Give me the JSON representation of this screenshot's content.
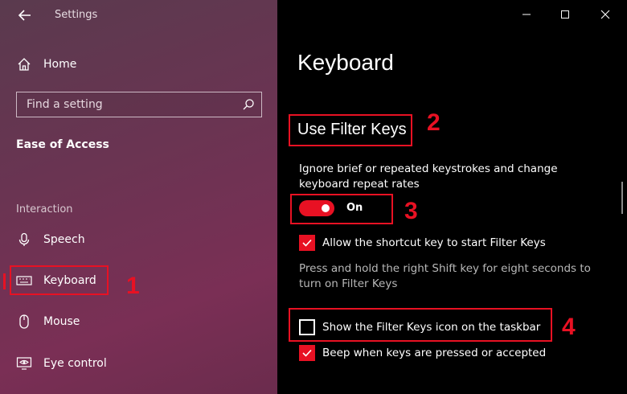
{
  "window": {
    "title": "Settings"
  },
  "sidebar": {
    "home_label": "Home",
    "search_placeholder": "Find a setting",
    "section_title": "Ease of Access",
    "group_label": "Interaction",
    "items": [
      {
        "label": "Speech",
        "icon": "microphone-icon"
      },
      {
        "label": "Keyboard",
        "icon": "keyboard-icon",
        "selected": true
      },
      {
        "label": "Mouse",
        "icon": "mouse-icon"
      },
      {
        "label": "Eye control",
        "icon": "eye-control-icon"
      }
    ]
  },
  "main": {
    "page_title": "Keyboard",
    "section_heading": "Use Filter Keys",
    "description": "Ignore brief or repeated keystrokes and change keyboard repeat rates",
    "toggle": {
      "label": "On",
      "value": true
    },
    "checkboxes": [
      {
        "label": "Allow the shortcut key to start Filter Keys",
        "checked": true
      },
      {
        "label": "Show the Filter Keys icon on the taskbar",
        "checked": false
      },
      {
        "label": "Beep when keys are pressed or accepted",
        "checked": true
      }
    ],
    "help_text": "Press and hold the right Shift key for eight seconds to turn on Filter Keys"
  },
  "annotations": {
    "callout_1": "1",
    "callout_2": "2",
    "callout_3": "3",
    "callout_4": "4"
  },
  "colors": {
    "accent": "#e81123",
    "sidebar_bg": "#6a3452",
    "main_bg": "#000000"
  }
}
